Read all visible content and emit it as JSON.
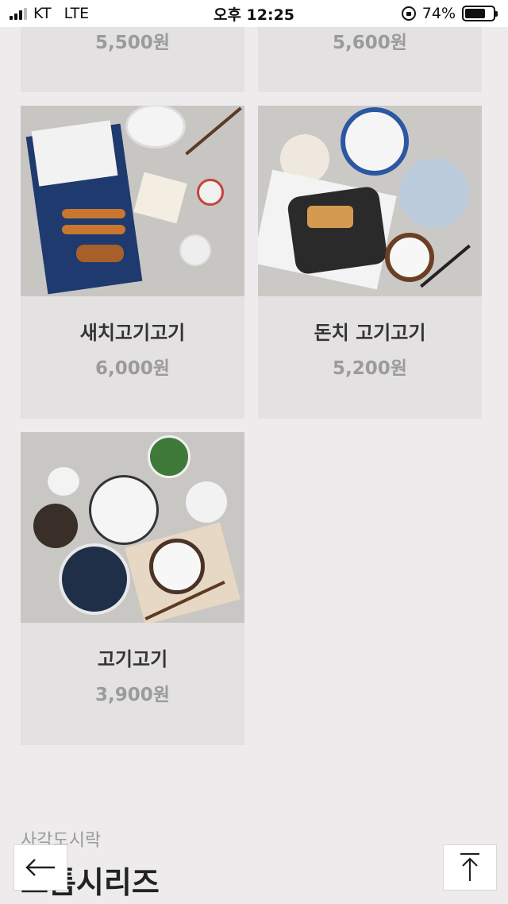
{
  "status_bar": {
    "carrier": "KT",
    "network": "LTE",
    "time": "오후 12:25",
    "battery_text": "74%",
    "battery_level": 0.74
  },
  "products": [
    {
      "name": "",
      "price": "5,500원"
    },
    {
      "name": "",
      "price": "5,600원"
    },
    {
      "name": "새치고기고기",
      "price": "6,000원"
    },
    {
      "name": "돈치 고기고기",
      "price": "5,200원"
    },
    {
      "name": "고기고기",
      "price": "3,900원"
    }
  ],
  "section": {
    "subtitle": "사각도시락",
    "title": "도톰시리즈"
  },
  "icons": {
    "back": "arrow-left-icon",
    "top": "arrow-up-icon"
  }
}
